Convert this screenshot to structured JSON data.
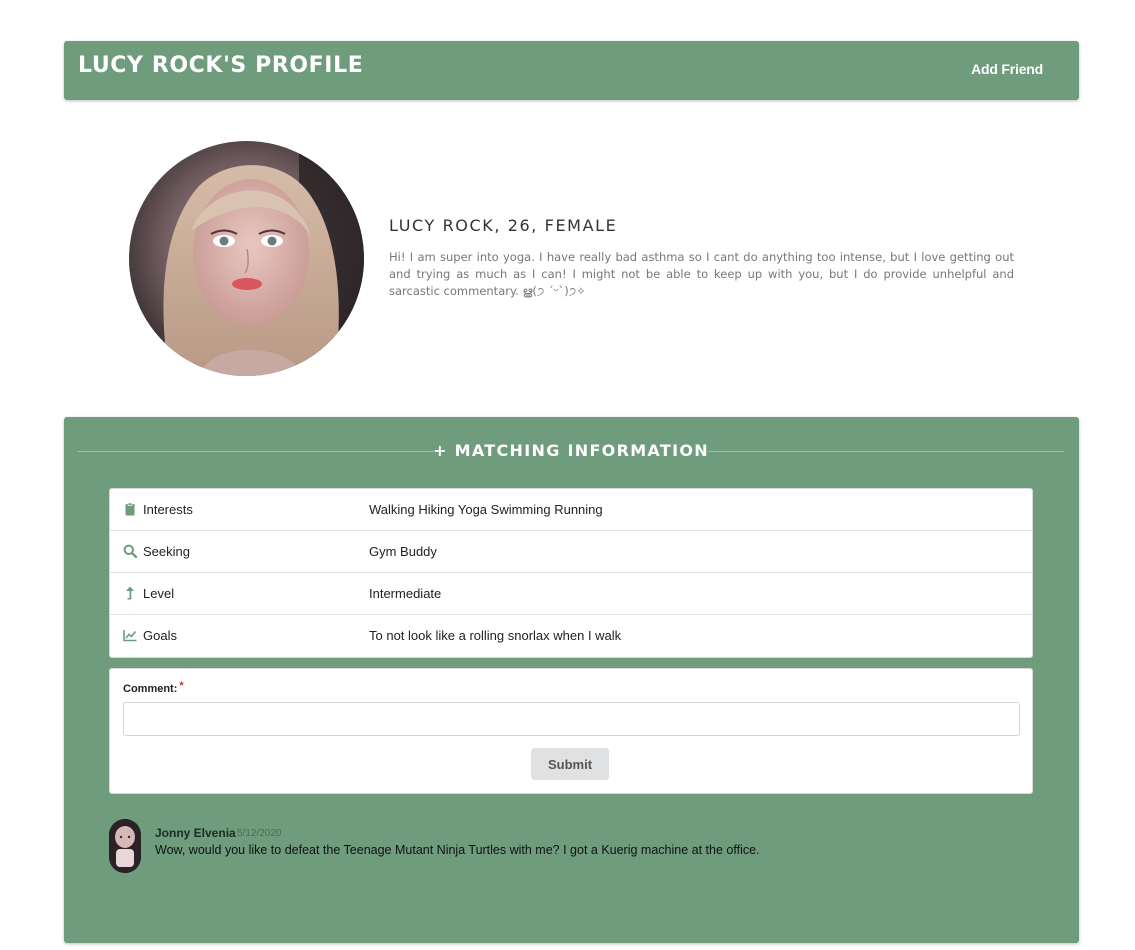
{
  "header": {
    "title": "LUCY ROCK'S PROFILE",
    "add_friend_label": "Add Friend"
  },
  "profile": {
    "name_line": "LUCY ROCK, 26, FEMALE",
    "bio": "Hi! I am super into yoga. I have really bad asthma so I cant do anything too intense, but I love getting out and trying as much as I can! I might not be able to keep up with you, but I do provide unhelpful and sarcastic commentary. ൠ(੭ ˊᵕˋ)੭✧"
  },
  "matching": {
    "section_title": "+ MATCHING INFORMATION",
    "rows": [
      {
        "icon": "clipboard-icon",
        "key": "Interests",
        "value": "Walking Hiking Yoga Swimming Running"
      },
      {
        "icon": "search-icon",
        "key": "Seeking",
        "value": "Gym Buddy"
      },
      {
        "icon": "arrow-up-icon",
        "key": "Level",
        "value": "Intermediate"
      },
      {
        "icon": "line-chart-icon",
        "key": "Goals",
        "value": "To not look like a rolling snorlax when I walk"
      }
    ]
  },
  "comment_form": {
    "label": "Comment:",
    "required_mark": "*",
    "input_value": "",
    "submit_label": "Submit"
  },
  "comments": [
    {
      "author": "Jonny Elvenia",
      "date": "5/12/2020",
      "text": "Wow, would you like to defeat the Teenage Mutant Ninja Turtles with me? I got a Kuerig machine at the office."
    }
  ],
  "colors": {
    "panel_green": "#6e9c7c",
    "icon_green": "#6e9c7c",
    "required_red": "#d0312d"
  }
}
